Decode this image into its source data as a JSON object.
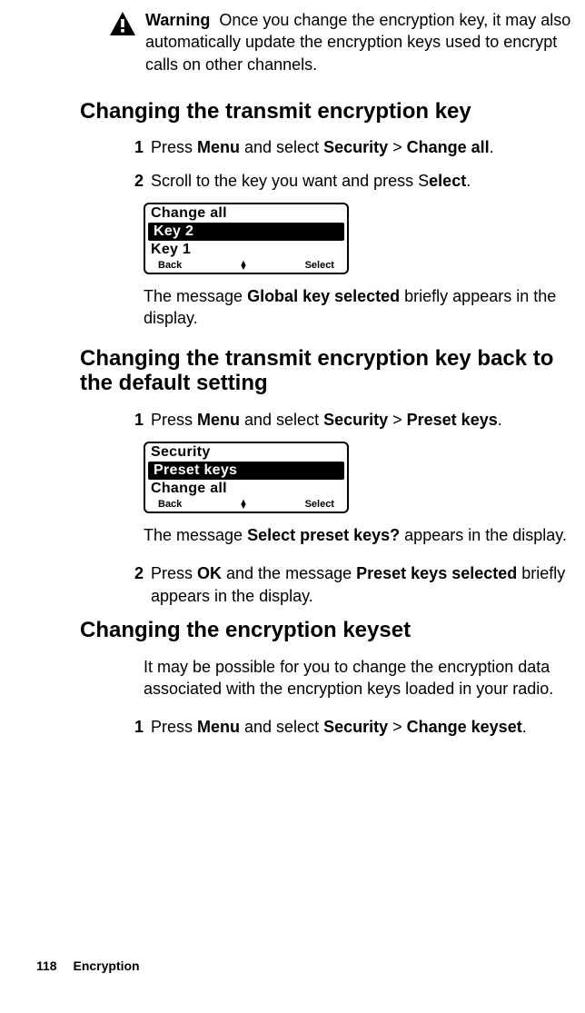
{
  "warning": {
    "label": "Warning",
    "text": "Once you change the encryption key, it may also automatically update the encryption keys used to encrypt calls on other channels."
  },
  "sections": {
    "transmit": {
      "heading": "Changing the transmit encryption key",
      "step1_pre": "Press ",
      "step1_b1": "Menu",
      "step1_mid1": " and select ",
      "step1_b2": "Security",
      "step1_mid2": " > ",
      "step1_b3": "Change all",
      "step1_post": ".",
      "step2_pre": "Scroll to the key you want and press S",
      "step2_b1": "elect",
      "step2_post": ".",
      "result_pre": "The message ",
      "result_b": "Global key selected",
      "result_post": " briefly appears in the display."
    },
    "default": {
      "heading": "Changing the transmit encryption key back to the default setting",
      "step1_pre": "Press ",
      "step1_b1": "Menu",
      "step1_mid1": " and select ",
      "step1_b2": "Security",
      "step1_mid2": " > ",
      "step1_b3": "Preset keys",
      "step1_post": ".",
      "result_pre": "The message ",
      "result_b": "Select preset keys?",
      "result_post": " appears in the display.",
      "step2_pre": "Press ",
      "step2_b1": "OK",
      "step2_mid1": " and the message ",
      "step2_b2": "Preset keys selected",
      "step2_post": " briefly appears in the display."
    },
    "keyset": {
      "heading": "Changing the encryption keyset",
      "intro": "It may be possible for you to change the encryption data associated with the encryption keys loaded in your radio.",
      "step1_pre": "Press ",
      "step1_b1": "Menu",
      "step1_mid1": " and select ",
      "step1_b2": "Security",
      "step1_mid2": " > ",
      "step1_b3": "Change keyset",
      "step1_post": "."
    }
  },
  "lcd1": {
    "line1": "Change all",
    "line2": "Key 2",
    "line3": "Key 1",
    "left": "Back",
    "right": "Select"
  },
  "lcd2": {
    "line1": "Security",
    "line2": "Preset keys",
    "line3": "Change all",
    "left": "Back",
    "right": "Select"
  },
  "footer": {
    "page": "118",
    "section": "Encryption"
  },
  "nums": {
    "n1": "1",
    "n2": "2"
  }
}
